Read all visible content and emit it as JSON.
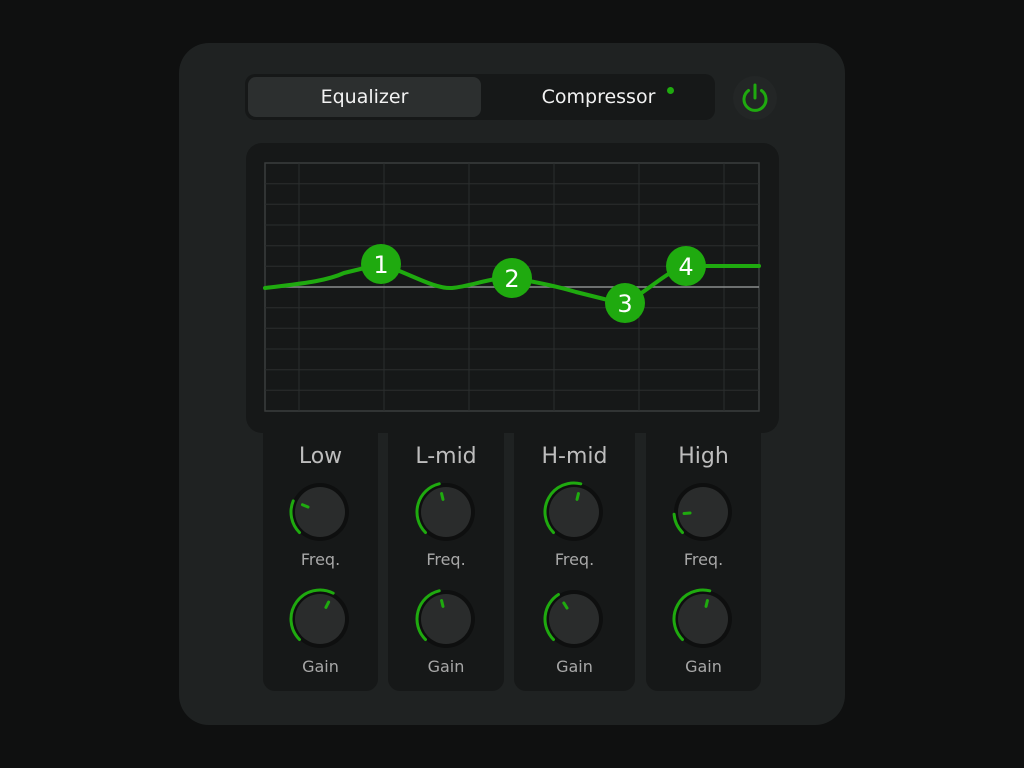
{
  "tabs": {
    "equalizer": "Equalizer",
    "compressor": "Compressor"
  },
  "graph": {
    "handles": [
      "1",
      "2",
      "3",
      "4"
    ]
  },
  "bands": [
    {
      "name": "Low",
      "freq_label": "Freq.",
      "gain_label": "Gain",
      "freq_level": 0.25,
      "gain_level": 0.6
    },
    {
      "name": "L-mid",
      "freq_label": "Freq.",
      "gain_label": "Gain",
      "freq_level": 0.45,
      "gain_level": 0.45
    },
    {
      "name": "H-mid",
      "freq_label": "Freq.",
      "gain_label": "Gain",
      "freq_level": 0.55,
      "gain_level": 0.38
    },
    {
      "name": "High",
      "freq_label": "Freq.",
      "gain_label": "Gain",
      "freq_level": 0.15,
      "gain_level": 0.55
    }
  ],
  "colors": {
    "accent": "#1faa0f",
    "panel": "#1f2222",
    "well": "#161818"
  },
  "icons": {
    "power": "power-icon"
  }
}
